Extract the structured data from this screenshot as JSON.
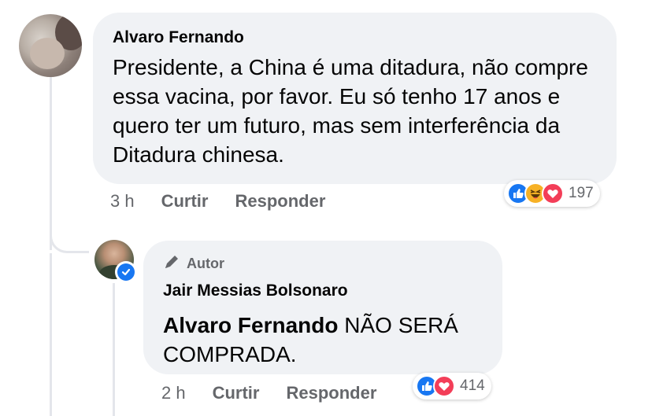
{
  "comment": {
    "author": "Alvaro Fernando",
    "text": "Presidente, a China é uma ditadura, não compre essa vacina, por favor. Eu só tenho 17 anos e quero ter um futuro, mas sem interferência da Ditadura chinesa.",
    "time": "3 h",
    "like_label": "Curtir",
    "reply_label": "Responder",
    "reaction_count": "197",
    "reactions": [
      "like-icon",
      "haha-icon",
      "love-icon"
    ]
  },
  "reply": {
    "badge_label": "Autor",
    "author": "Jair Messias Bolsonaro",
    "mention": "Alvaro Fernando",
    "text": " NÃO SERÁ COMPRADA.",
    "time": "2 h",
    "like_label": "Curtir",
    "reply_label": "Responder",
    "reaction_count": "414",
    "reactions": [
      "like-icon",
      "love-icon"
    ]
  },
  "colors": {
    "bubble": "#f0f2f5",
    "secondary_text": "#65676b",
    "like": "#1877f2",
    "love": "#f33e58",
    "haha": "#f7b125"
  }
}
